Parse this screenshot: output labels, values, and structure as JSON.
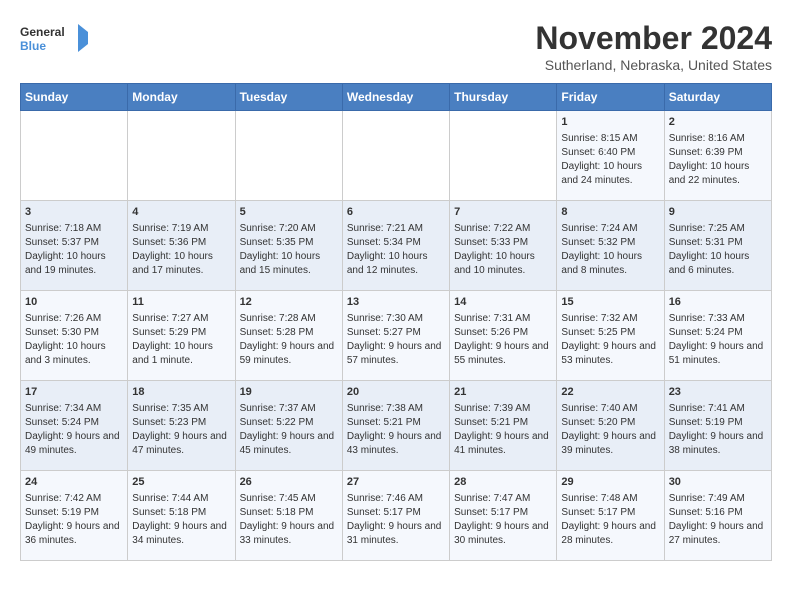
{
  "header": {
    "logo_line1": "General",
    "logo_line2": "Blue",
    "month": "November 2024",
    "location": "Sutherland, Nebraska, United States"
  },
  "weekdays": [
    "Sunday",
    "Monday",
    "Tuesday",
    "Wednesday",
    "Thursday",
    "Friday",
    "Saturday"
  ],
  "weeks": [
    [
      {
        "day": "",
        "info": ""
      },
      {
        "day": "",
        "info": ""
      },
      {
        "day": "",
        "info": ""
      },
      {
        "day": "",
        "info": ""
      },
      {
        "day": "",
        "info": ""
      },
      {
        "day": "1",
        "info": "Sunrise: 8:15 AM\nSunset: 6:40 PM\nDaylight: 10 hours and 24 minutes."
      },
      {
        "day": "2",
        "info": "Sunrise: 8:16 AM\nSunset: 6:39 PM\nDaylight: 10 hours and 22 minutes."
      }
    ],
    [
      {
        "day": "3",
        "info": "Sunrise: 7:18 AM\nSunset: 5:37 PM\nDaylight: 10 hours and 19 minutes."
      },
      {
        "day": "4",
        "info": "Sunrise: 7:19 AM\nSunset: 5:36 PM\nDaylight: 10 hours and 17 minutes."
      },
      {
        "day": "5",
        "info": "Sunrise: 7:20 AM\nSunset: 5:35 PM\nDaylight: 10 hours and 15 minutes."
      },
      {
        "day": "6",
        "info": "Sunrise: 7:21 AM\nSunset: 5:34 PM\nDaylight: 10 hours and 12 minutes."
      },
      {
        "day": "7",
        "info": "Sunrise: 7:22 AM\nSunset: 5:33 PM\nDaylight: 10 hours and 10 minutes."
      },
      {
        "day": "8",
        "info": "Sunrise: 7:24 AM\nSunset: 5:32 PM\nDaylight: 10 hours and 8 minutes."
      },
      {
        "day": "9",
        "info": "Sunrise: 7:25 AM\nSunset: 5:31 PM\nDaylight: 10 hours and 6 minutes."
      }
    ],
    [
      {
        "day": "10",
        "info": "Sunrise: 7:26 AM\nSunset: 5:30 PM\nDaylight: 10 hours and 3 minutes."
      },
      {
        "day": "11",
        "info": "Sunrise: 7:27 AM\nSunset: 5:29 PM\nDaylight: 10 hours and 1 minute."
      },
      {
        "day": "12",
        "info": "Sunrise: 7:28 AM\nSunset: 5:28 PM\nDaylight: 9 hours and 59 minutes."
      },
      {
        "day": "13",
        "info": "Sunrise: 7:30 AM\nSunset: 5:27 PM\nDaylight: 9 hours and 57 minutes."
      },
      {
        "day": "14",
        "info": "Sunrise: 7:31 AM\nSunset: 5:26 PM\nDaylight: 9 hours and 55 minutes."
      },
      {
        "day": "15",
        "info": "Sunrise: 7:32 AM\nSunset: 5:25 PM\nDaylight: 9 hours and 53 minutes."
      },
      {
        "day": "16",
        "info": "Sunrise: 7:33 AM\nSunset: 5:24 PM\nDaylight: 9 hours and 51 minutes."
      }
    ],
    [
      {
        "day": "17",
        "info": "Sunrise: 7:34 AM\nSunset: 5:24 PM\nDaylight: 9 hours and 49 minutes."
      },
      {
        "day": "18",
        "info": "Sunrise: 7:35 AM\nSunset: 5:23 PM\nDaylight: 9 hours and 47 minutes."
      },
      {
        "day": "19",
        "info": "Sunrise: 7:37 AM\nSunset: 5:22 PM\nDaylight: 9 hours and 45 minutes."
      },
      {
        "day": "20",
        "info": "Sunrise: 7:38 AM\nSunset: 5:21 PM\nDaylight: 9 hours and 43 minutes."
      },
      {
        "day": "21",
        "info": "Sunrise: 7:39 AM\nSunset: 5:21 PM\nDaylight: 9 hours and 41 minutes."
      },
      {
        "day": "22",
        "info": "Sunrise: 7:40 AM\nSunset: 5:20 PM\nDaylight: 9 hours and 39 minutes."
      },
      {
        "day": "23",
        "info": "Sunrise: 7:41 AM\nSunset: 5:19 PM\nDaylight: 9 hours and 38 minutes."
      }
    ],
    [
      {
        "day": "24",
        "info": "Sunrise: 7:42 AM\nSunset: 5:19 PM\nDaylight: 9 hours and 36 minutes."
      },
      {
        "day": "25",
        "info": "Sunrise: 7:44 AM\nSunset: 5:18 PM\nDaylight: 9 hours and 34 minutes."
      },
      {
        "day": "26",
        "info": "Sunrise: 7:45 AM\nSunset: 5:18 PM\nDaylight: 9 hours and 33 minutes."
      },
      {
        "day": "27",
        "info": "Sunrise: 7:46 AM\nSunset: 5:17 PM\nDaylight: 9 hours and 31 minutes."
      },
      {
        "day": "28",
        "info": "Sunrise: 7:47 AM\nSunset: 5:17 PM\nDaylight: 9 hours and 30 minutes."
      },
      {
        "day": "29",
        "info": "Sunrise: 7:48 AM\nSunset: 5:17 PM\nDaylight: 9 hours and 28 minutes."
      },
      {
        "day": "30",
        "info": "Sunrise: 7:49 AM\nSunset: 5:16 PM\nDaylight: 9 hours and 27 minutes."
      }
    ]
  ]
}
